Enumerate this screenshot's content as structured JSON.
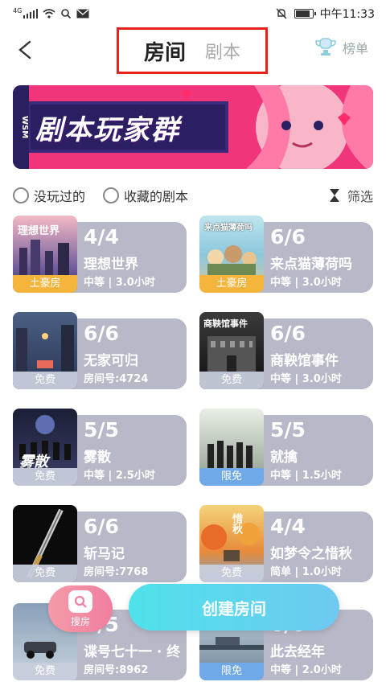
{
  "status": {
    "network": "4G",
    "time": "中午11:33"
  },
  "header": {
    "tabs": [
      {
        "label": "房间",
        "active": true
      },
      {
        "label": "剧本",
        "active": false
      }
    ],
    "rank_label": "榜单"
  },
  "banner": {
    "title": "剧本玩家群",
    "side_text": "WSM"
  },
  "filter": {
    "option1": "没玩过的",
    "option2": "收藏的剧本",
    "filter_label": "筛选"
  },
  "rooms": [
    {
      "count": "4/4",
      "name": "理想世界",
      "meta": "中等 | 3.0小时",
      "tag": "土豪房",
      "thumb_title": "理想世界",
      "tag_color": "gold"
    },
    {
      "count": "6/6",
      "name": "来点猫薄荷吗",
      "meta": "中等 | 3.0小时",
      "tag": "土豪房",
      "thumb_title": "来点猫薄荷吗",
      "tag_color": "gold"
    },
    {
      "count": "6/6",
      "name": "无家可归",
      "meta": "房间号:4724",
      "tag": "免费",
      "thumb_title": "",
      "tag_color": "gray"
    },
    {
      "count": "6/6",
      "name": "商鞅馆事件",
      "meta": "中等 | 3.0小时",
      "tag": "免费",
      "thumb_title": "商鞅馆事件",
      "tag_color": "gray"
    },
    {
      "count": "5/5",
      "name": "雾散",
      "meta": "中等 | 2.5小时",
      "tag": "免费",
      "thumb_title": "雾散",
      "tag_color": "gray"
    },
    {
      "count": "5/5",
      "name": "就擒",
      "meta": "中等 | 1.5小时",
      "tag": "限免",
      "thumb_title": "",
      "tag_color": "blue"
    },
    {
      "count": "6/6",
      "name": "斩马记",
      "meta": "房间号:7768",
      "tag": "免费",
      "thumb_title": "",
      "tag_color": "gray"
    },
    {
      "count": "4/4",
      "name": "如梦令之惜秋",
      "meta": "简单 | 1.0小时",
      "tag": "免费",
      "thumb_title": "惜秋",
      "tag_color": "gray"
    },
    {
      "count": "5/5",
      "name": "谍号七十一 · 终",
      "meta": "房间号:8962",
      "tag": "免费",
      "thumb_title": "",
      "tag_color": "gray"
    },
    {
      "count": "6/6",
      "name": "此去经年",
      "meta": "中等 | 2.0小时",
      "tag": "限免",
      "thumb_title": "",
      "tag_color": "blue"
    }
  ],
  "actions": {
    "search_label": "搜房",
    "create_label": "创建房间"
  }
}
